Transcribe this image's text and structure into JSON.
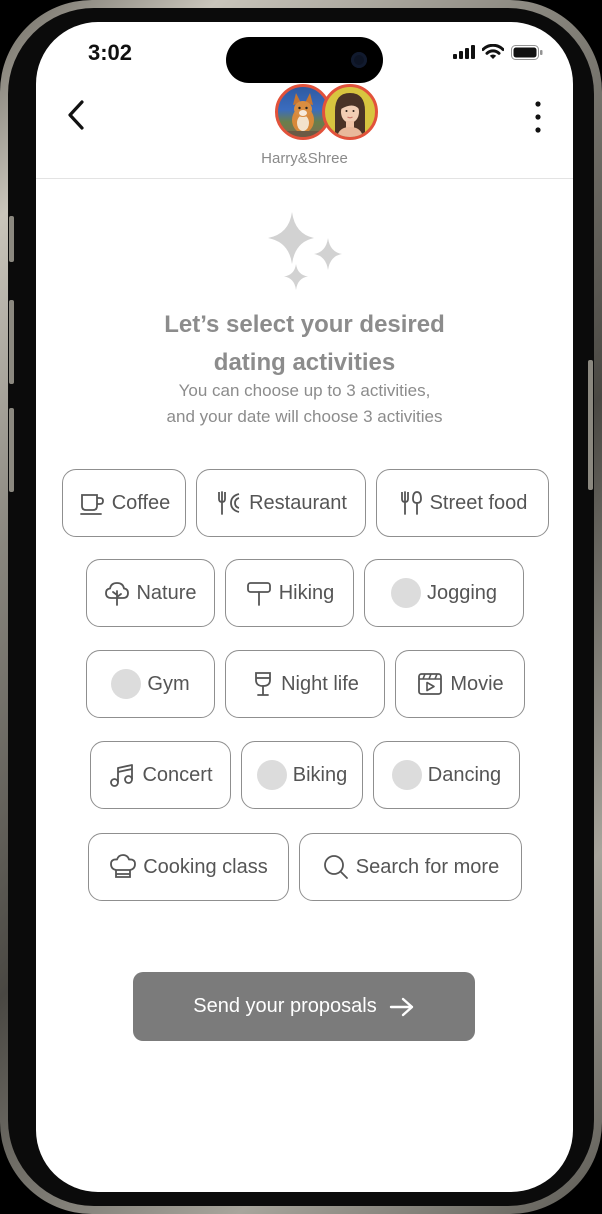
{
  "status_bar": {
    "time": "3:02"
  },
  "header": {
    "pair_name": "Harry&Shree"
  },
  "intro": {
    "title_line1": "Let’s select your desired",
    "title_line2": "dating activities",
    "subtitle_line1": "You can choose up to 3 activities,",
    "subtitle_line2": "and your date will choose 3 activities"
  },
  "activities": [
    {
      "label": "Coffee",
      "icon": "coffee-icon"
    },
    {
      "label": "Restaurant",
      "icon": "restaurant-icon"
    },
    {
      "label": "Street food",
      "icon": "fork-knife-icon"
    },
    {
      "label": "Nature",
      "icon": "tree-icon"
    },
    {
      "label": "Hiking",
      "icon": "signpost-icon"
    },
    {
      "label": "Jogging",
      "icon": "placeholder-circle"
    },
    {
      "label": "Gym",
      "icon": "placeholder-circle"
    },
    {
      "label": "Night life",
      "icon": "wine-glass-icon"
    },
    {
      "label": "Movie",
      "icon": "film-icon"
    },
    {
      "label": "Concert",
      "icon": "music-note-icon"
    },
    {
      "label": "Biking",
      "icon": "placeholder-circle"
    },
    {
      "label": "Dancing",
      "icon": "placeholder-circle"
    },
    {
      "label": "Cooking class",
      "icon": "chef-hat-icon"
    },
    {
      "label": "Search for more",
      "icon": "search-icon"
    }
  ],
  "cta": {
    "label": "Send your proposals",
    "icon": "arrow-right-icon"
  },
  "colors": {
    "border": "#8f8f8f",
    "text": "#555555",
    "cta_bg": "#7b7b7b",
    "avatar_ring": "#e2523b",
    "placeholder": "#dcdcdc"
  }
}
